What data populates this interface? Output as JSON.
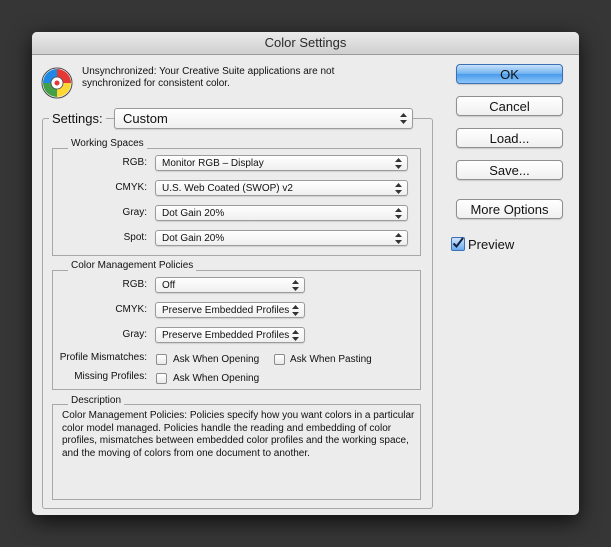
{
  "dialog": {
    "title": "Color Settings",
    "sync_message_line1": "Unsynchronized: Your Creative Suite applications are not",
    "sync_message_line2": "synchronized for consistent color."
  },
  "settings": {
    "label": "Settings:",
    "value": "Custom"
  },
  "working_spaces": {
    "legend": "Working Spaces",
    "rows": [
      {
        "label": "RGB:",
        "value": "Monitor RGB – Display"
      },
      {
        "label": "CMYK:",
        "value": "U.S. Web Coated (SWOP) v2"
      },
      {
        "label": "Gray:",
        "value": "Dot Gain 20%"
      },
      {
        "label": "Spot:",
        "value": "Dot Gain 20%"
      }
    ]
  },
  "policies": {
    "legend": "Color Management Policies",
    "rows": [
      {
        "label": "RGB:",
        "value": "Off"
      },
      {
        "label": "CMYK:",
        "value": "Preserve Embedded Profiles"
      },
      {
        "label": "Gray:",
        "value": "Preserve Embedded Profiles"
      }
    ],
    "profile_mismatches_label": "Profile Mismatches:",
    "ask_when_opening": "Ask When Opening",
    "ask_when_pasting": "Ask When Pasting",
    "missing_profiles_label": "Missing Profiles:",
    "missing_ask_when_opening": "Ask When Opening"
  },
  "description": {
    "legend": "Description",
    "lines": [
      "Color Management Policies:  Policies specify how you want colors in a particular",
      "color model managed.  Policies handle the reading and embedding of color",
      "profiles, mismatches between embedded color profiles and the working space,",
      "and the moving of colors from one document to another."
    ]
  },
  "buttons": {
    "ok": "OK",
    "cancel": "Cancel",
    "load": "Load...",
    "save": "Save...",
    "more_options": "More Options"
  },
  "preview": {
    "label": "Preview",
    "checked": true
  },
  "colors": {
    "primary_button": "#4a9beb",
    "window_background": "#ececec",
    "desktop_background": "#363636"
  }
}
